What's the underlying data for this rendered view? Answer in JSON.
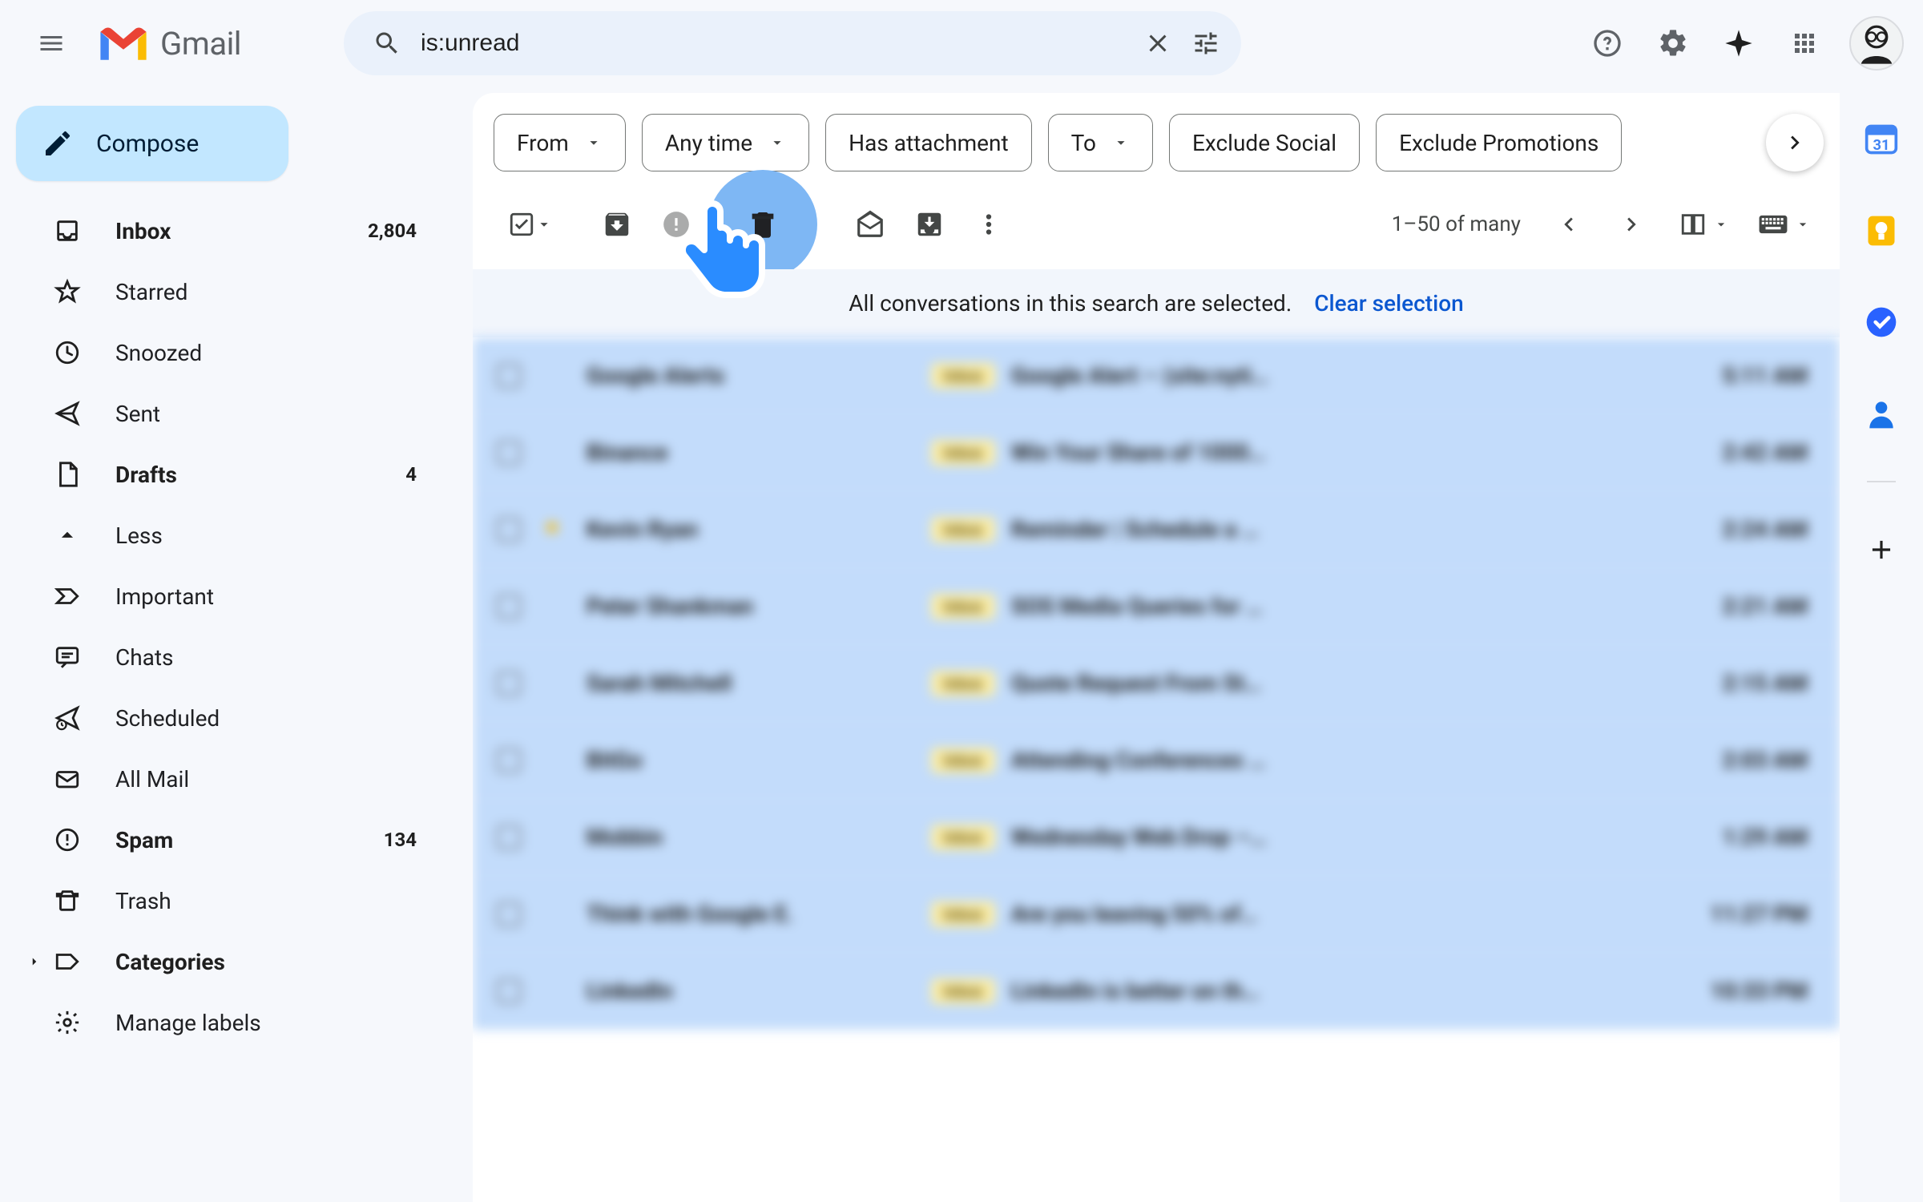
{
  "header": {
    "product": "Gmail",
    "search_value": "is:unread"
  },
  "sidebar": {
    "compose": "Compose",
    "items": [
      {
        "icon": "inbox",
        "label": "Inbox",
        "count": "2,804",
        "bold": true
      },
      {
        "icon": "star",
        "label": "Starred"
      },
      {
        "icon": "clock",
        "label": "Snoozed"
      },
      {
        "icon": "send",
        "label": "Sent"
      },
      {
        "icon": "draft",
        "label": "Drafts",
        "count": "4",
        "bold": true
      },
      {
        "icon": "less",
        "label": "Less"
      },
      {
        "icon": "important",
        "label": "Important"
      },
      {
        "icon": "chats",
        "label": "Chats"
      },
      {
        "icon": "scheduled",
        "label": "Scheduled"
      },
      {
        "icon": "allmail",
        "label": "All Mail"
      },
      {
        "icon": "spam",
        "label": "Spam",
        "count": "134",
        "bold": true
      },
      {
        "icon": "trash",
        "label": "Trash"
      },
      {
        "icon": "categories",
        "label": "Categories",
        "bold": true
      },
      {
        "icon": "manage",
        "label": "Manage labels"
      }
    ]
  },
  "chips": [
    {
      "label": "From",
      "dropdown": true
    },
    {
      "label": "Any time",
      "dropdown": true
    },
    {
      "label": "Has attachment",
      "dropdown": false
    },
    {
      "label": "To",
      "dropdown": true
    },
    {
      "label": "Exclude Social",
      "dropdown": false
    },
    {
      "label": "Exclude Promotions",
      "dropdown": false
    }
  ],
  "toolbar": {
    "page_indicator": "1–50 of many"
  },
  "selection_banner": {
    "text": "All conversations in this search are selected.",
    "action": "Clear selection"
  },
  "emails": [
    {
      "sender": "Google Alerts",
      "label": "Inbox",
      "subject": "Google Alert – (site:nyti…",
      "time": "5:11 AM"
    },
    {
      "sender": "Binance",
      "label": "Inbox",
      "subject": "Win Your Share of 1000…",
      "time": "2:42 AM"
    },
    {
      "sender": "Kevin Ryan",
      "label": "Inbox",
      "subject": "Reminder | Schedule a …",
      "time": "2:24 AM",
      "starred": true
    },
    {
      "sender": "Peter Shankman",
      "label": "Inbox",
      "subject": "SOS Media Queries for …",
      "time": "2:21 AM"
    },
    {
      "sender": "Sarah Mitchell",
      "label": "Inbox",
      "subject": "Quote Request From St…",
      "time": "2:15 AM"
    },
    {
      "sender": "BitGo",
      "label": "Inbox",
      "subject": "Attending Conferences …",
      "time": "2:03 AM"
    },
    {
      "sender": "Mobbin",
      "label": "Inbox",
      "subject": "Wednesday Web Drop –…",
      "time": "1:29 AM"
    },
    {
      "sender": "Think with Google E.",
      "label": "Inbox",
      "subject": "Are you leaving 50% of…",
      "time": "11:27 PM"
    },
    {
      "sender": "LinkedIn",
      "label": "Inbox",
      "subject": "LinkedIn is better on th…",
      "time": "10:33 PM"
    }
  ],
  "sidepanel_apps": [
    "calendar",
    "keep",
    "tasks",
    "contacts"
  ]
}
